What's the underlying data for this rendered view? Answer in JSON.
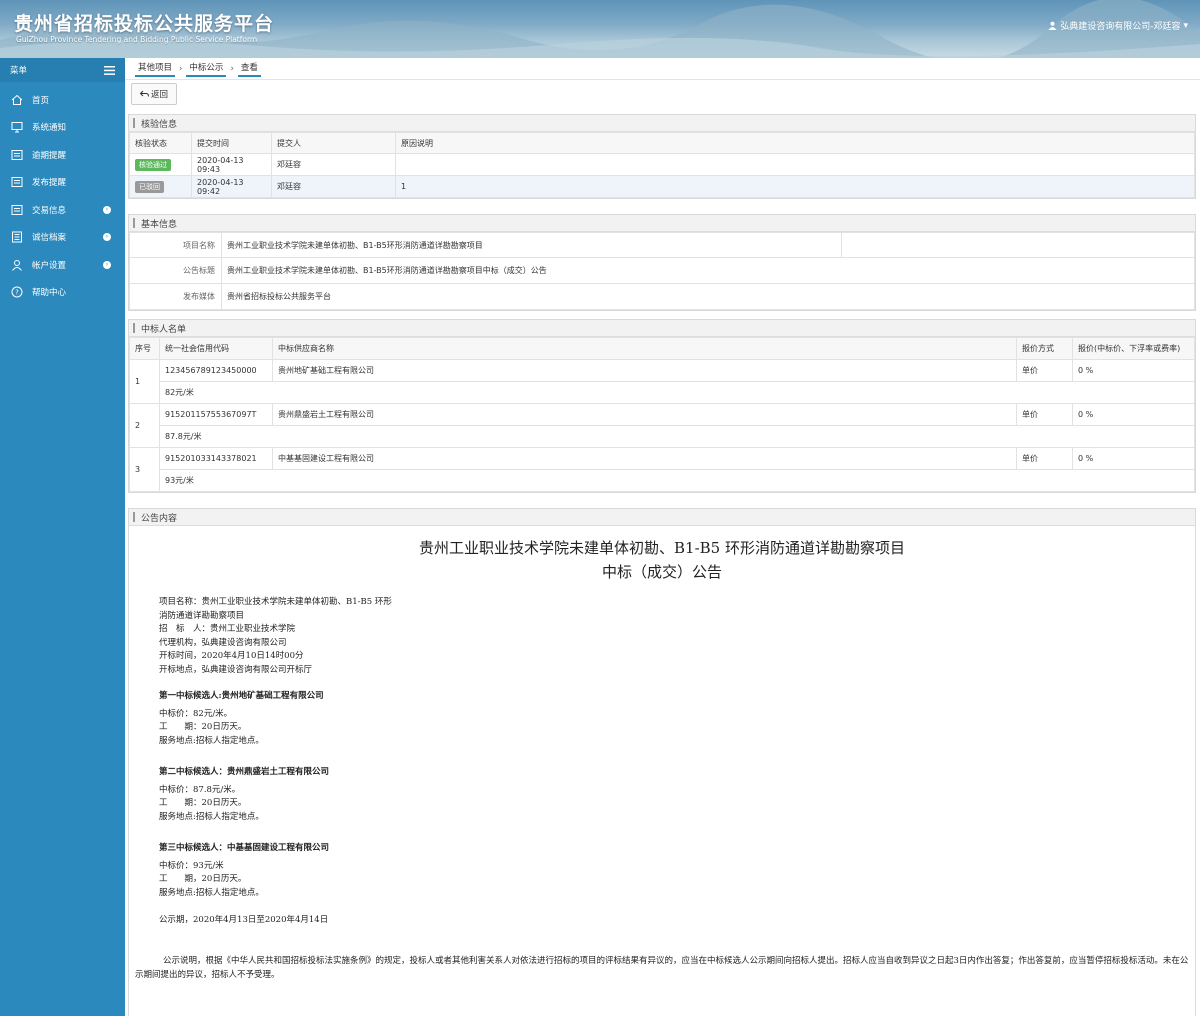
{
  "header": {
    "title": "贵州省招标投标公共服务平台",
    "subtitle": "GuiZhou Province Tendering and Bidding Public Service Platform",
    "user": "弘典建设咨询有限公司-邓廷容",
    "user_caret": "▾"
  },
  "sidebar": {
    "menu_label": "菜单",
    "items": [
      {
        "label": "首页",
        "icon": "home-icon"
      },
      {
        "label": "系统通知",
        "icon": "monitor-icon"
      },
      {
        "label": "逾期提醒",
        "icon": "list-icon"
      },
      {
        "label": "发布提醒",
        "icon": "list-icon"
      },
      {
        "label": "交易信息",
        "icon": "list-icon",
        "expand": "›"
      },
      {
        "label": "诚信档案",
        "icon": "archive-icon",
        "expand": "›"
      },
      {
        "label": "帐户设置",
        "icon": "user-icon",
        "expand": "›"
      },
      {
        "label": "帮助中心",
        "icon": "help-icon"
      }
    ]
  },
  "breadcrumb": [
    "其他项目",
    "中标公示",
    "查看"
  ],
  "back_label": "返回",
  "verify": {
    "title": "核验信息",
    "headers": [
      "核验状态",
      "提交时间",
      "提交人",
      "原因说明"
    ],
    "rows": [
      {
        "status": "核验通过",
        "status_color": "#5cb85c",
        "time": "2020-04-13 09:43",
        "person": "邓廷容",
        "reason": ""
      },
      {
        "status": "已驳回",
        "status_color": "#999999",
        "time": "2020-04-13 09:42",
        "person": "邓廷容",
        "reason": "1"
      }
    ]
  },
  "basic": {
    "title": "基本信息",
    "rows": [
      {
        "label": "项目名称",
        "value": "贵州工业职业技术学院未建单体初勘、B1-B5环形消防通道详勘勘察项目"
      },
      {
        "label": "公告标题",
        "value": "贵州工业职业技术学院未建单体初勘、B1-B5环形消防通道详勘勘察项目中标（成交）公告"
      },
      {
        "label": "发布媒体",
        "value": "贵州省招标投标公共服务平台"
      }
    ]
  },
  "winners": {
    "title": "中标人名单",
    "headers": [
      "序号",
      "统一社会信用代码",
      "中标供应商名称",
      "报价方式",
      "报价(中标价、下浮率或费率)"
    ],
    "rows": [
      {
        "no": "1",
        "code": "123456789123450000",
        "name": "贵州地矿基础工程有限公司",
        "method": "单价",
        "rate": "0 %",
        "price": "82元/米"
      },
      {
        "no": "2",
        "code": "91520115755367097T",
        "name": "贵州鼎盛岩土工程有限公司",
        "method": "单价",
        "rate": "0 %",
        "price": "87.8元/米"
      },
      {
        "no": "3",
        "code": "915201033143378021",
        "name": "中基基固建设工程有限公司",
        "method": "单价",
        "rate": "0 %",
        "price": "93元/米"
      }
    ]
  },
  "notice": {
    "title": "公告内容",
    "heading1": "贵州工业职业技术学院未建单体初勘、B1-B5 环形消防通道详勘勘察项目",
    "heading2": "中标（成交）公告",
    "info": [
      "项目名称：贵州工业职业技术学院未建单体初勘、B1-B5 环形",
      "消防通道详勘勘察项目",
      "招　标　人：贵州工业职业技术学院",
      "代理机构，弘典建设咨询有限公司",
      "开标时间，2020年4月10日14时00分",
      "开标地点，弘典建设咨询有限公司开标厅"
    ],
    "candidates": [
      {
        "title": "第一中标候选人:贵州地矿基础工程有限公司",
        "lines": [
          "中标价：82元/米。",
          "工　　期：20日历天。",
          "服务地点:招标人指定地点。"
        ]
      },
      {
        "title": "第二中标候选人：贵州鼎盛岩土工程有限公司",
        "lines": [
          "中标价：87.8元/米。",
          "工　　期：20日历天。",
          "服务地点:招标人指定地点。"
        ]
      },
      {
        "title": "第三中标候选人：中基基固建设工程有限公司",
        "lines": [
          "中标价：93元/米",
          "工　　期，20日历天。",
          "服务地点:招标人指定地点。"
        ]
      }
    ],
    "period": "公示期，2020年4月13日至2020年4月14日",
    "footer": "公示说明，根据《中华人民共和国招标投标法实施条例》的规定，投标人或者其他利害关系人对依法进行招标的项目的评标结果有异议的，应当在中标候选人公示期间向招标人提出。招标人应当自收到异议之日起3日内作出答复；作出答复前，应当暂停招标投标活动。未在公示期间提出的异议，招标人不予受理。"
  }
}
